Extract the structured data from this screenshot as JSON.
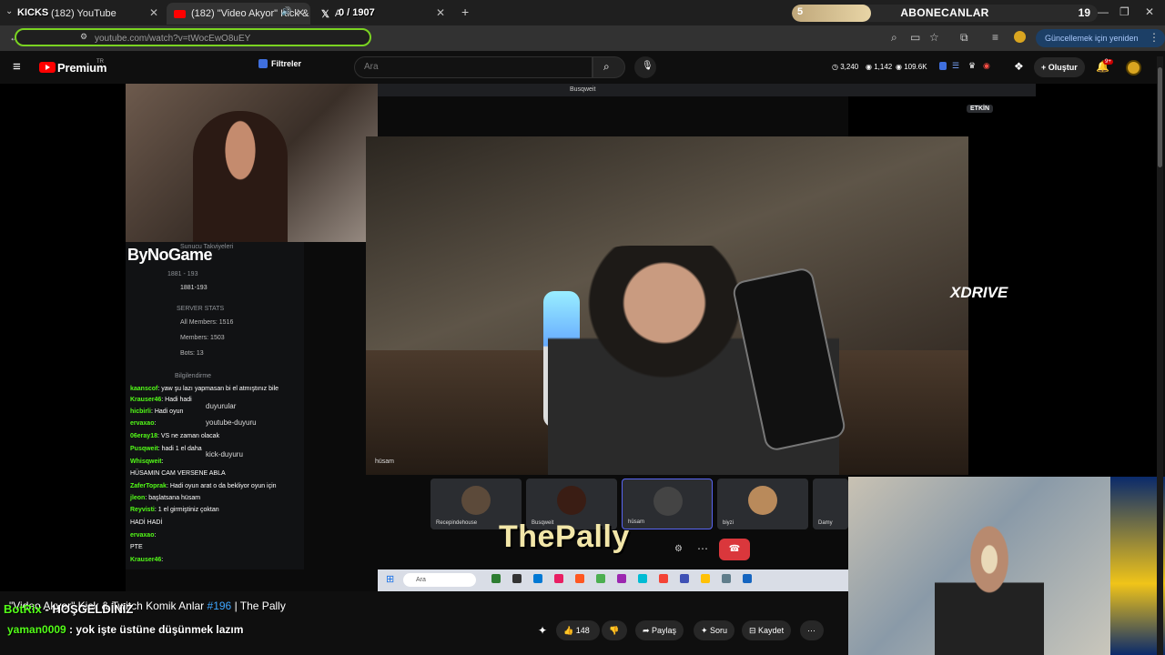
{
  "browser": {
    "tabs": [
      {
        "label": "(182) YouTube",
        "active": false
      },
      {
        "label": "(182) \"Video Akyor\" Kick &",
        "active": true
      },
      {
        "label": "A",
        "active": false
      }
    ],
    "kicks_label": "KICKS",
    "counter_label": "0 / 1907",
    "new_tab": "+",
    "subscriber_bar": {
      "left": "5",
      "label": "ABONECANLAR",
      "right": "19",
      "progress": 0.26
    },
    "url": "youtube.com/watch?v=tWocEwO8uEY",
    "update_button": "Güncellemek için yeniden başlat"
  },
  "youtube": {
    "brand": "Premium",
    "region": "TR",
    "filter_label": "Filtreler",
    "search_placeholder": "Ara",
    "stats": {
      "a": "3,240",
      "b": "1,142",
      "c": "109.6K"
    },
    "create_label": "Oluştur",
    "notif_badge": "9+"
  },
  "video": {
    "discord_window_title": "Busqweit",
    "facecam_overlay": "ByNoGame",
    "etkin": "ETKİN",
    "xdrive": "XDRIVE",
    "speaker_name": "hüsam",
    "discord_side": [
      "Sunucu Takviyeleri",
      "1881 - 193",
      "1881-193",
      "SERVER STATS",
      "All Members: 1516",
      "Members: 1503",
      "Bots: 13",
      "Bilgilendirme",
      "duyurular",
      "youtube-duyuru",
      "kick-duyuru"
    ],
    "chat": [
      {
        "user": "kaanscof",
        "msg": ": yaw şu lazı yapmasan bi el atmıştınız bile"
      },
      {
        "user": "Krauser46",
        "msg": ": Hadi hadi"
      },
      {
        "user": "hicbirli",
        "msg": ": Hadi oyun"
      },
      {
        "user": "ervaxao",
        "msg": ":"
      },
      {
        "user": "06eray18",
        "msg": ": VS ne zaman olacak"
      },
      {
        "user": "Pusqweit",
        "msg": ": hadi 1 el daha"
      },
      {
        "user": "Whisqweit",
        "msg": ":"
      },
      {
        "user": "",
        "msg": "HÜSAMIN CAM VERSENE ABLA"
      },
      {
        "user": "ZaferToprak",
        "msg": ": Hadi oyun arat o da bekliyor oyun için"
      },
      {
        "user": "jleon",
        "msg": ": başlatsana hüsam"
      },
      {
        "user": "Reyvisti",
        "msg": ": 1 el girmiştiniz çoktan"
      },
      {
        "user": "",
        "msg": "HADİ HADİ"
      },
      {
        "user": "ervaxao",
        "msg": ":"
      },
      {
        "user": "",
        "msg": "PTE"
      },
      {
        "user": "Krauser46",
        "msg": ":"
      }
    ],
    "participants": [
      "Recepindehouse",
      "Busqweit",
      "hüsam",
      "biyzi",
      "Damy"
    ],
    "pally_logo": "ThePally",
    "taskbar_search": "Ara"
  },
  "below": {
    "video_title_prefix": "\"Video Akyor\" Kick & Twitch Komik Anlar",
    "video_title_hash": "#196",
    "video_title_suffix": "| The Pally",
    "kick_chat": [
      {
        "user": "BotRix",
        "msg": " - HOŞGELDİNİZ"
      },
      {
        "user": "yaman0009",
        "msg": " : yok işte üstüne düşünmek lazım"
      }
    ],
    "actions": {
      "likes": "148",
      "share": "Paylaş",
      "ask": "Soru",
      "save": "Kaydet",
      "more": "⋯"
    }
  },
  "colors": {
    "kick_green": "#53fc18",
    "yt_red": "#ff0000",
    "url_highlight": "#7ad321"
  }
}
